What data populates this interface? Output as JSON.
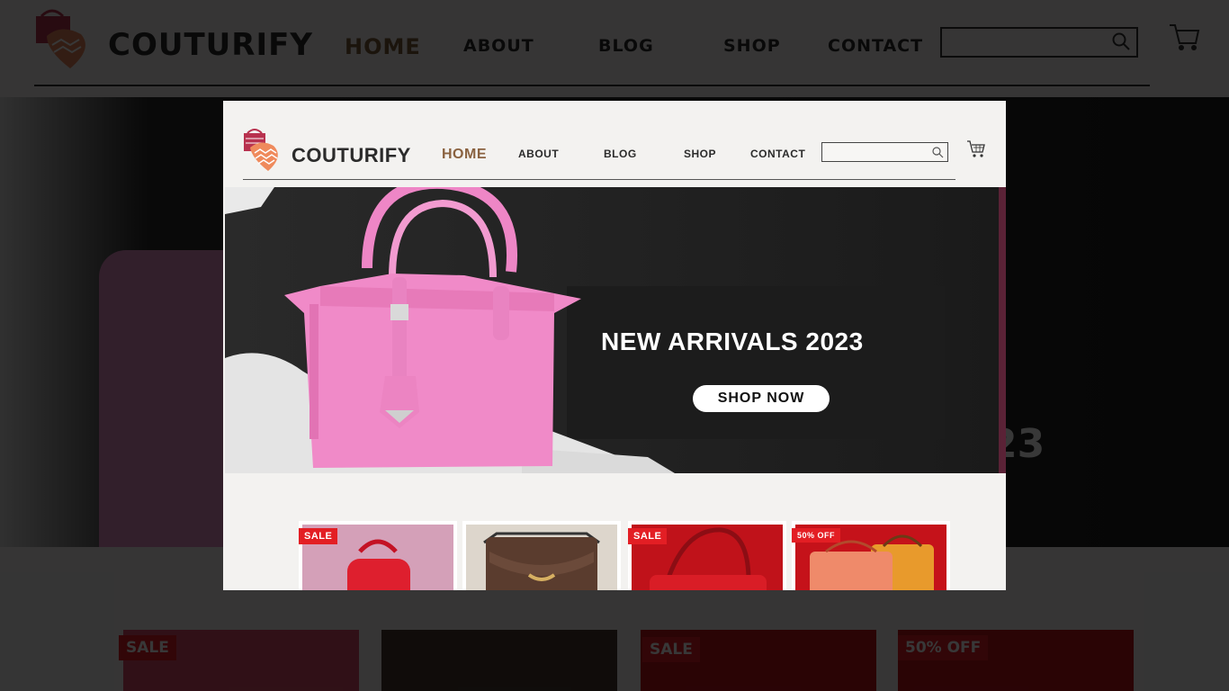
{
  "brand": {
    "name": "COUTURIFY"
  },
  "nav": {
    "items": [
      {
        "label": "HOME",
        "active": true
      },
      {
        "label": "ABOUT",
        "active": false
      },
      {
        "label": "BLOG",
        "active": false
      },
      {
        "label": "SHOP",
        "active": false
      },
      {
        "label": "CONTACT",
        "active": false
      }
    ]
  },
  "search": {
    "placeholder": "",
    "value": "",
    "icon": "search-icon"
  },
  "cart": {
    "icon": "cart-icon"
  },
  "hero": {
    "title": "NEW ARRIVALS 2023",
    "button_label": "SHOP NOW",
    "background_partial_text": "23"
  },
  "products": [
    {
      "badge": "SALE",
      "image": "red bowling handbag",
      "color": "#d94c6a"
    },
    {
      "badge": "",
      "image": "brown saddle bag",
      "color": "#5a3c2e"
    },
    {
      "badge": "SALE",
      "image": "red top-handle bag",
      "color": "#c0121a"
    },
    {
      "badge": "50% OFF",
      "image": "orange satchel bags",
      "color": "#e8743a"
    }
  ],
  "colors": {
    "accent": "#8a6240",
    "sale_red": "#e31e24",
    "hero_bag_pink": "#f08ac8",
    "page_bg": "#f3f2f0"
  }
}
